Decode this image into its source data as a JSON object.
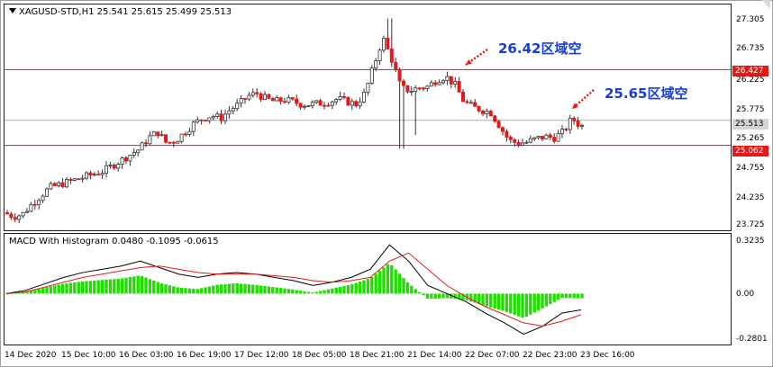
{
  "chart": {
    "symbol_line": "XAGUSD-STD,H1  25.541 25.615 25.499 25.513",
    "macd_line": "MACD With Histogram 0.0480 -0.1095 -0.0615",
    "annotations": [
      "26.42区域空",
      "25.65区域空"
    ],
    "price_axis": [
      "27.305",
      "26.735",
      "26.427",
      "26.225",
      "25.775",
      "25.513",
      "25.265",
      "25.062",
      "24.755",
      "24.235",
      "23.725"
    ],
    "macd_axis": [
      "0.3235",
      "0.00",
      "-0.2801"
    ],
    "time_axis": [
      "14 Dec 2020",
      "15 Dec 10:00",
      "16 Dec 03:00",
      "16 Dec 19:00",
      "17 Dec 12:00",
      "18 Dec 05:00",
      "18 Dec 21:00",
      "21 Dec 14:00",
      "22 Dec 07:00",
      "22 Dec 23:00",
      "23 Dec 16:00"
    ],
    "hlines": [
      {
        "value": 26.427,
        "color": "#e41a1a"
      },
      {
        "value": 25.062,
        "color": "#e41a1a"
      }
    ],
    "bid_line": {
      "value": 25.513,
      "color": "#b0b0b0"
    },
    "colors": {
      "bull": "#ffffff",
      "bear": "#e41a1a",
      "wick": "#333333",
      "macd": "#000000",
      "signal": "#e41a1a",
      "hist": "#22dd00",
      "arrow": "#e41a1a",
      "annotation": "#1a3fd6"
    }
  },
  "chart_data": {
    "type": "candlestick",
    "title": "XAGUSD-STD,H1",
    "ylim": [
      23.5,
      27.6
    ],
    "close_path_x": [
      0,
      10,
      20,
      30,
      40,
      50,
      60,
      70,
      80,
      90,
      100,
      110,
      120,
      130,
      140,
      150,
      160,
      170,
      180,
      190,
      200,
      210,
      220,
      230,
      240,
      250,
      260,
      270,
      280,
      290,
      300,
      310,
      320,
      330,
      340,
      350,
      360,
      370,
      380,
      390,
      400,
      410,
      420,
      430,
      440,
      450,
      460,
      470,
      480,
      490,
      500,
      510,
      520,
      530,
      540,
      550,
      560,
      570,
      580,
      590,
      600,
      610,
      620,
      630,
      640,
      650
    ],
    "close_path_y": [
      23.85,
      23.78,
      23.82,
      24.0,
      24.15,
      24.3,
      24.35,
      24.4,
      24.45,
      24.5,
      24.55,
      24.6,
      24.7,
      24.8,
      24.9,
      25.0,
      25.2,
      25.3,
      25.1,
      25.15,
      25.3,
      25.45,
      25.55,
      25.6,
      25.55,
      25.7,
      25.8,
      25.95,
      26.0,
      25.9,
      25.85,
      25.88,
      25.85,
      25.8,
      25.8,
      25.82,
      25.85,
      25.9,
      25.85,
      25.8,
      26.0,
      26.5,
      27.0,
      26.6,
      26.1,
      26.05,
      26.1,
      26.12,
      26.25,
      26.3,
      26.15,
      25.85,
      25.75,
      25.7,
      25.65,
      25.4,
      25.15,
      25.1,
      25.12,
      25.18,
      25.22,
      25.2,
      25.3,
      25.55,
      25.4,
      25.5
    ],
    "macd_ylim": [
      -0.2801,
      0.3235
    ],
    "macd": [
      0.0,
      0.02,
      0.06,
      0.1,
      0.13,
      0.15,
      0.17,
      0.2,
      0.16,
      0.12,
      0.1,
      0.12,
      0.13,
      0.12,
      0.1,
      0.08,
      0.05,
      0.07,
      0.1,
      0.15,
      0.3,
      0.2,
      0.05,
      0.0,
      -0.05,
      -0.12,
      -0.18,
      -0.25,
      -0.2,
      -0.12,
      -0.1
    ],
    "signal": [
      0.0,
      0.01,
      0.04,
      0.07,
      0.1,
      0.12,
      0.14,
      0.16,
      0.17,
      0.15,
      0.13,
      0.12,
      0.12,
      0.12,
      0.11,
      0.1,
      0.08,
      0.07,
      0.08,
      0.1,
      0.2,
      0.25,
      0.15,
      0.05,
      -0.02,
      -0.08,
      -0.13,
      -0.18,
      -0.2,
      -0.17,
      -0.13
    ]
  }
}
